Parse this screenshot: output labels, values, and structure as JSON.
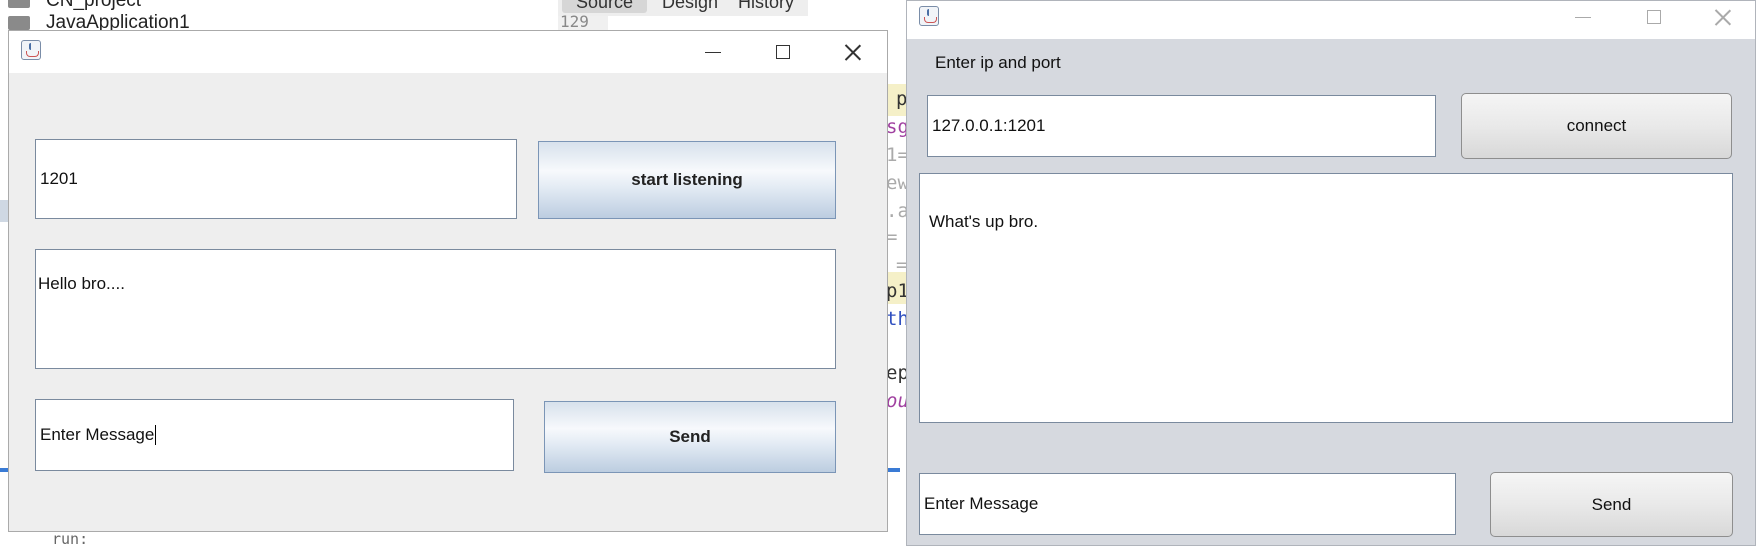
{
  "ide": {
    "tree_items": [
      "CN_project",
      "JavaApplication1"
    ],
    "editor_tabs": [
      "Source",
      "Design",
      "History"
    ],
    "line_number": "129",
    "code_fragments": [
      "p",
      "sg",
      "1=",
      "ew",
      ".a",
      "=",
      "=",
      "p1",
      "th",
      "ep",
      "ou"
    ],
    "console_text": "run:"
  },
  "server_window": {
    "port_value": "1201",
    "start_button_label": "start listening",
    "received_text": "Hello bro....",
    "message_value": "Enter Message",
    "send_button_label": "Send"
  },
  "client_window": {
    "prompt_label": "Enter ip and port",
    "address_value": "127.0.0.1:1201",
    "connect_button_label": "connect",
    "received_text": "What's up bro.",
    "message_value": "Enter Message",
    "send_button_label": "Send"
  },
  "colors": {
    "nimbus_button": "#c9d7e6",
    "window_bg": "#eeeeee",
    "client_bg": "#d6d9df"
  },
  "icons": [
    "java-cup-icon",
    "minimize-icon",
    "maximize-icon",
    "close-icon",
    "folder-icon"
  ]
}
